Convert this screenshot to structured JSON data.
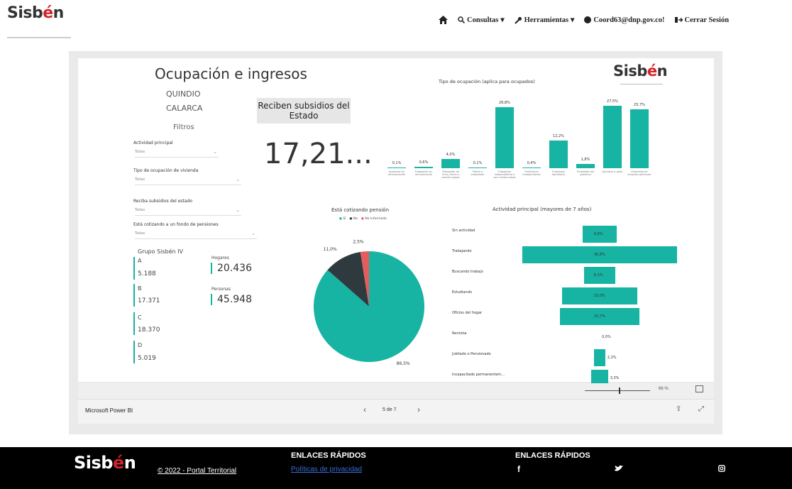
{
  "header": {
    "logo_text_a": "Sisb",
    "logo_text_e": "é",
    "logo_text_b": "n",
    "nav": {
      "home_icon": "home-icon",
      "consultas": "Consultas",
      "herramientas": "Herramientas",
      "user_email": "Coord63@dnp.gov.co!",
      "logout": "Cerrar Sesión"
    }
  },
  "report": {
    "title": "Ocupación e ingresos",
    "department": "QUINDIO",
    "municipality": "CALARCA",
    "filters_title": "Filtros",
    "filters": [
      {
        "label": "Actividad principal",
        "value": "Todas"
      },
      {
        "label": "Tipo de ocupación de vivienda",
        "value": "Todas"
      },
      {
        "label": "Reciba subsidios del estado",
        "value": "Todas"
      },
      {
        "label": "Está cotizando a un fondo de pensiones",
        "value": "Todas"
      }
    ],
    "kpi_label": "Reciben subsidios del Estado",
    "kpi_value": "17,21...",
    "grupo_title": "Grupo Sisbén IV",
    "grupos": [
      {
        "letter": "A",
        "value": "5.188"
      },
      {
        "letter": "B",
        "value": "17.371"
      },
      {
        "letter": "C",
        "value": "18.370"
      },
      {
        "letter": "D",
        "value": "5.019"
      }
    ],
    "hogares_label": "Hogares",
    "hogares_value": "20.436",
    "personas_label": "Personas",
    "personas_value": "45.948",
    "brand_logo": "Sisbén"
  },
  "chart_data": [
    {
      "type": "bar",
      "title": "Tipo de ocupación (aplica para ocupados)",
      "categories": [
        "Ayudante sin remuneración",
        "Trabajador sin remuneración",
        "Trabajador de finca, tierra o parcela propia",
        "Patrón o empleador",
        "Trabajador independiente o por cuenta propia",
        "Profesional independiente",
        "Empleado doméstico",
        "Empleado del gobierno",
        "Jornalero o peón",
        "Empleado de empresa particular"
      ],
      "values": [
        0.1,
        0.6,
        4.0,
        0.1,
        26.8,
        0.4,
        12.2,
        1.8,
        27.5,
        25.7
      ],
      "labels": [
        "0,1%",
        "0,6%",
        "4,0%",
        "0,1%",
        "26,8%",
        "0,4%",
        "12,2%",
        "1,8%",
        "27,5%",
        "25,7%"
      ]
    },
    {
      "type": "pie",
      "title": "Está cotizando pensión",
      "legend": [
        "Sí",
        "No",
        "No informado"
      ],
      "colors": [
        "#17b3a3",
        "#2f3a3f",
        "#e35d5d"
      ],
      "values": [
        86.5,
        11.0,
        2.5
      ],
      "labels": [
        "86,5%",
        "11,0%",
        "2,5%"
      ]
    },
    {
      "type": "bar",
      "orientation": "horizontal",
      "title": "Actividad principal (mayores de 7 años)",
      "categories": [
        "Sin actividad",
        "Trabajando",
        "Buscando trabajo",
        "Estudiando",
        "Oficios del hogar",
        "Rentista",
        "Jubilado o Pensionado",
        "Incapacitado permanentem..."
      ],
      "values": [
        6.8,
        30.8,
        6.1,
        15.0,
        15.7,
        0.0,
        2.2,
        3.3
      ],
      "labels": [
        "6,8%",
        "30,8%",
        "6,1%",
        "15,0%",
        "15,7%",
        "0,0%",
        "2,2%",
        "3,3%"
      ]
    }
  ],
  "pbi": {
    "brand": "Microsoft Power BI",
    "page_indicator": "5 de 7",
    "zoom": "66 %"
  },
  "footer": {
    "copyright": "© 2022 - Portal Territorial",
    "links_heading_1": "ENLACES RÁPIDOS",
    "privacy_link": "Políticas de privacidad",
    "links_heading_2": "ENLACES RÁPIDOS"
  },
  "colors": {
    "teal": "#17b3a3",
    "brand_red": "#d2232a",
    "dark": "#2f3a3f"
  }
}
